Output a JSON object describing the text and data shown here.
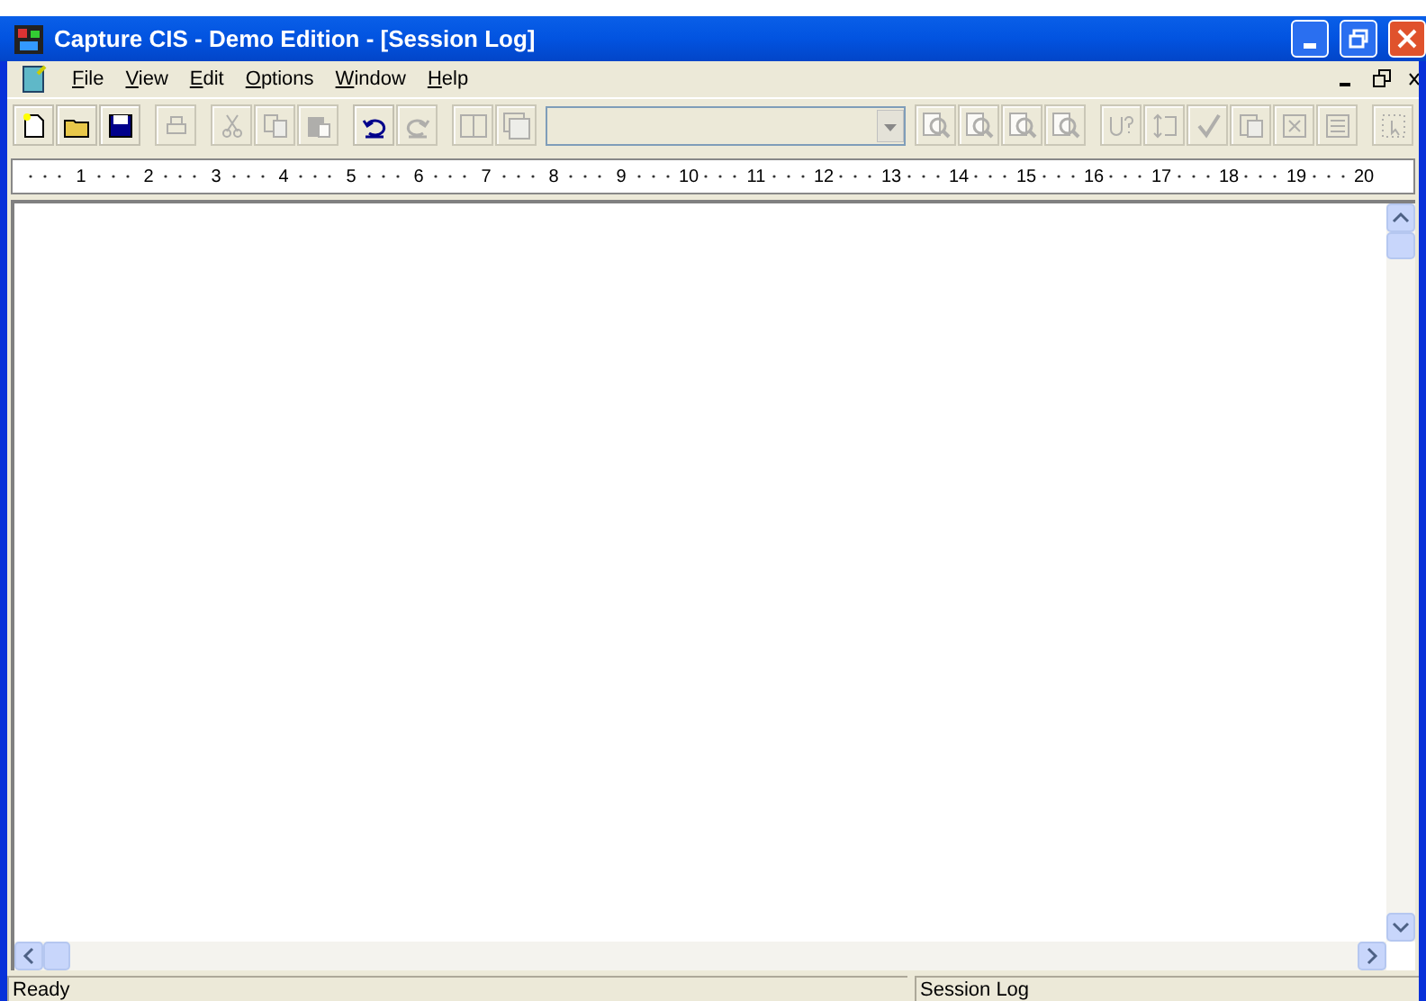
{
  "window": {
    "title": "Capture CIS - Demo Edition - [Session Log]"
  },
  "menu": [
    {
      "label": "File"
    },
    {
      "label": "View"
    },
    {
      "label": "Edit"
    },
    {
      "label": "Options"
    },
    {
      "label": "Window"
    },
    {
      "label": "Help"
    }
  ],
  "toolbar": [
    {
      "kind": "new",
      "disabled": false
    },
    {
      "kind": "open",
      "disabled": false
    },
    {
      "kind": "save",
      "disabled": false
    },
    {
      "kind": "sep"
    },
    {
      "kind": "print",
      "disabled": true
    },
    {
      "kind": "sep"
    },
    {
      "kind": "cut",
      "disabled": true
    },
    {
      "kind": "copy",
      "disabled": true
    },
    {
      "kind": "paste",
      "disabled": true
    },
    {
      "kind": "sep"
    },
    {
      "kind": "undo",
      "disabled": false
    },
    {
      "kind": "redo",
      "disabled": true
    },
    {
      "kind": "sep"
    },
    {
      "kind": "tile",
      "disabled": true
    },
    {
      "kind": "cascade",
      "disabled": true
    },
    {
      "kind": "combo",
      "disabled": true
    },
    {
      "kind": "zoomin",
      "disabled": true
    },
    {
      "kind": "zoomout",
      "disabled": true
    },
    {
      "kind": "zoomarea",
      "disabled": true
    },
    {
      "kind": "zoomall",
      "disabled": true
    },
    {
      "kind": "sep"
    },
    {
      "kind": "query",
      "disabled": true
    },
    {
      "kind": "annotate",
      "disabled": true
    },
    {
      "kind": "check",
      "disabled": true
    },
    {
      "kind": "netlist",
      "disabled": true
    },
    {
      "kind": "bom",
      "disabled": true
    },
    {
      "kind": "report",
      "disabled": true
    },
    {
      "kind": "sep"
    },
    {
      "kind": "pointer",
      "disabled": true
    }
  ],
  "ruler": [
    "1",
    "2",
    "3",
    "4",
    "5",
    "6",
    "7",
    "8",
    "9",
    "10",
    "11",
    "12",
    "13",
    "14",
    "15",
    "16",
    "17",
    "18",
    "19",
    "20"
  ],
  "status_bar": [
    "Ready",
    "Session Log"
  ]
}
